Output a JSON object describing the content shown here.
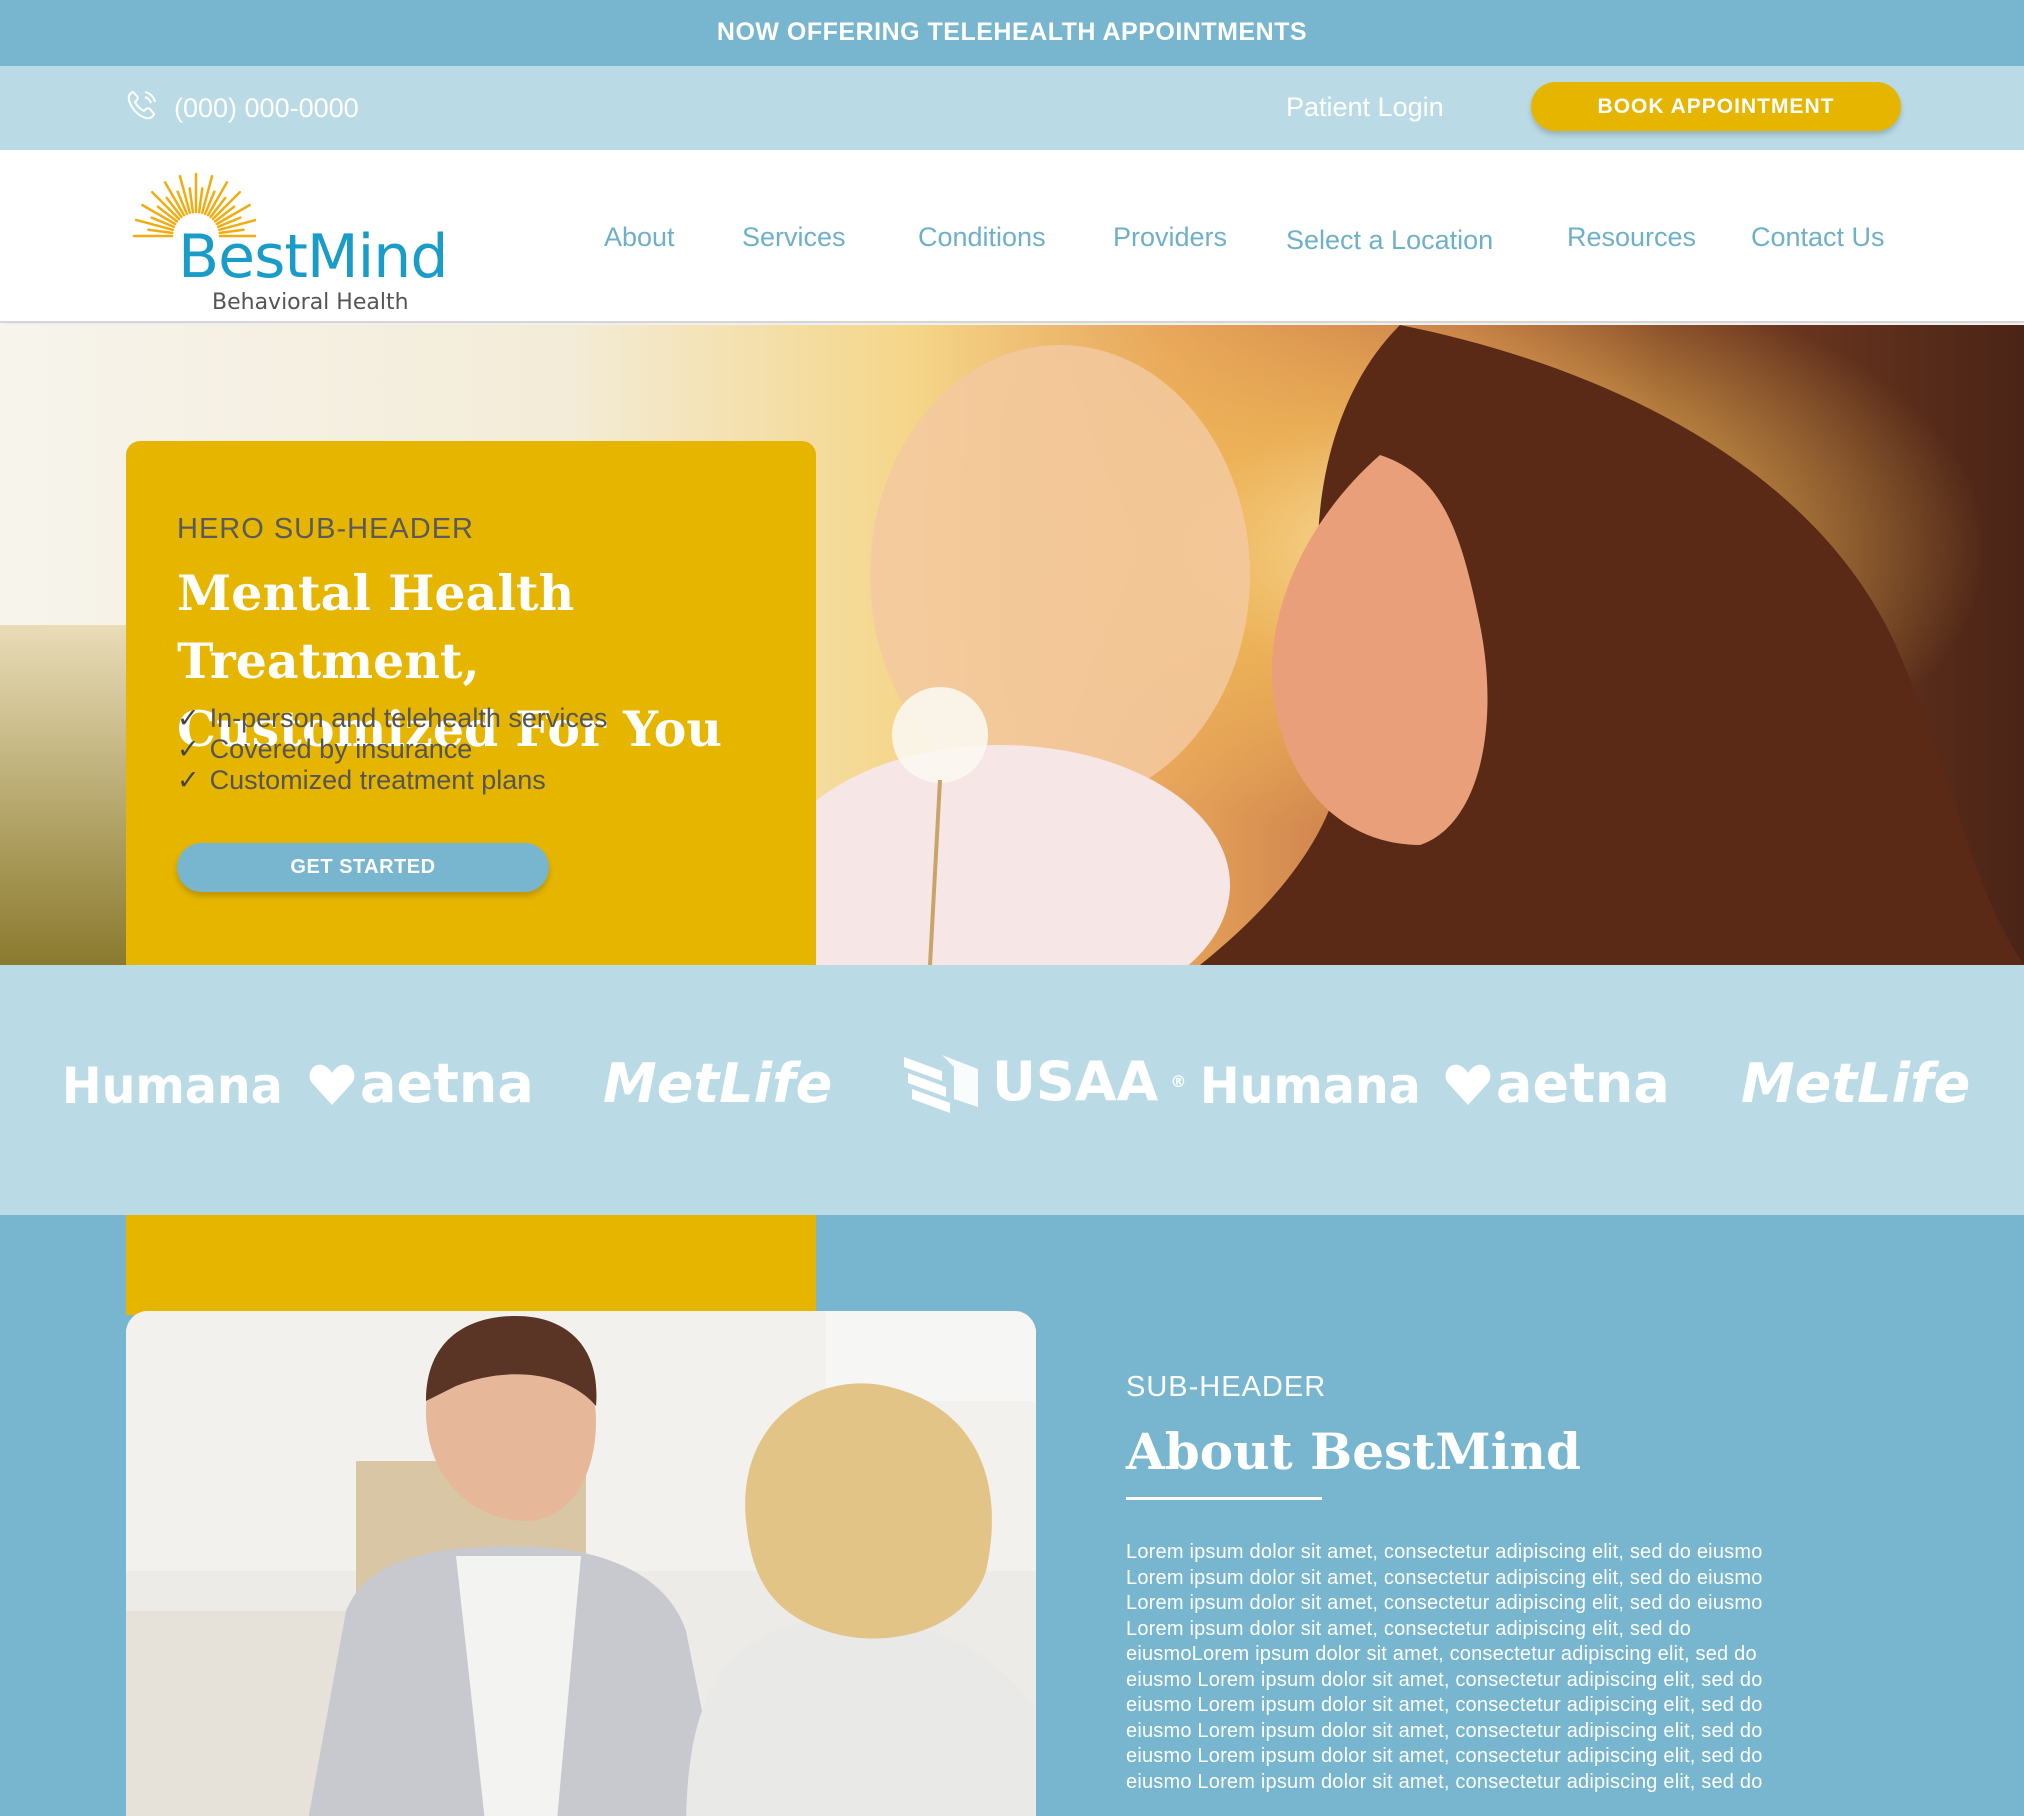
{
  "announcement": "NOW OFFERING TELEHEALTH APPOINTMENTS",
  "utility": {
    "phone": "(000) 000-0000",
    "patient_login": "Patient Login",
    "book_button": "BOOK  APPOINTMENT"
  },
  "logo": {
    "name": "BestMind",
    "tagline": "Behavioral Health"
  },
  "nav": {
    "items": [
      {
        "label": "About"
      },
      {
        "label": "Services"
      },
      {
        "label": "Conditions"
      },
      {
        "label": "Providers"
      },
      {
        "label": "Select a Location"
      },
      {
        "label": "Resources"
      },
      {
        "label": "Contact Us"
      }
    ]
  },
  "hero": {
    "subheader": "HERO SUB-HEADER",
    "title": "Mental Health Treatment, Customized For You",
    "bullets": [
      "In-person and telehealth services",
      "Covered by insurance",
      "Customized treatment plans"
    ],
    "cta": "GET STARTED"
  },
  "insurers": [
    "Humana",
    "aetna",
    "MetLife",
    "USAA",
    "Humana",
    "aetna",
    "MetLife"
  ],
  "about": {
    "subheader": "SUB-HEADER",
    "title": "About BestMind",
    "body_lines": [
      "Lorem ipsum dolor sit amet, consectetur adipiscing elit, sed do eiusmo",
      "Lorem ipsum dolor sit amet, consectetur adipiscing elit, sed do eiusmo",
      "Lorem ipsum dolor sit amet, consectetur adipiscing elit, sed do eiusmo",
      "Lorem ipsum dolor sit amet, consectetur adipiscing elit, sed do",
      "eiusmoLorem ipsum dolor sit amet, consectetur adipiscing elit, sed do",
      "eiusmo Lorem ipsum dolor sit amet, consectetur adipiscing elit, sed do",
      "eiusmo Lorem ipsum dolor sit amet, consectetur adipiscing elit, sed do",
      "eiusmo Lorem ipsum dolor sit amet, consectetur adipiscing elit, sed do",
      "eiusmo Lorem ipsum dolor sit amet, consectetur adipiscing elit, sed do",
      "eiusmo Lorem ipsum dolor sit amet, consectetur adipiscing elit, sed do"
    ]
  },
  "colors": {
    "announcement_bg": "#78b6cf",
    "utility_bg": "#badbe6",
    "accent_yellow": "#e6b500",
    "nav_text": "#6fb0c9",
    "logo_blue": "#1a9cc8"
  },
  "icons": {
    "phone": "phone-icon",
    "logo": "sunburst-logo-icon"
  }
}
